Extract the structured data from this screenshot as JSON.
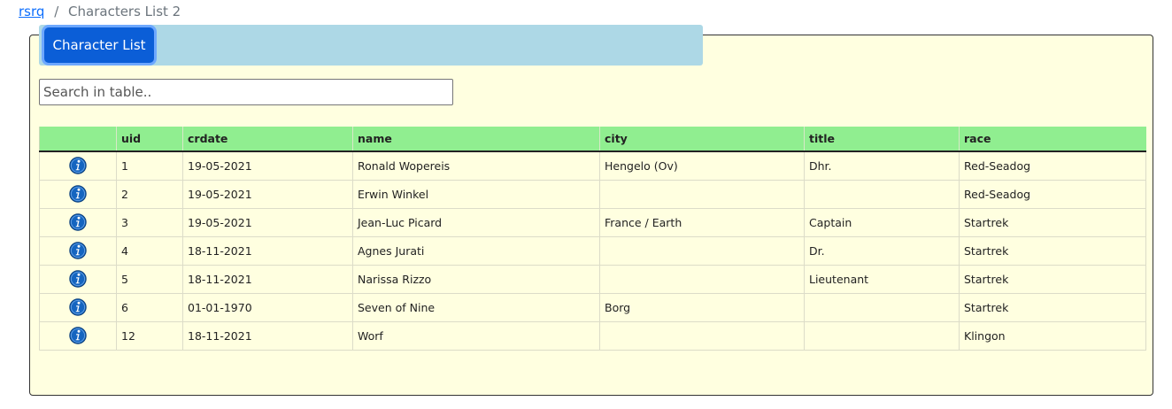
{
  "breadcrumb": {
    "home_label": "rsrq",
    "separator": "/",
    "current": "Characters List 2"
  },
  "tabs": {
    "active_label": "Character List"
  },
  "search": {
    "placeholder": "Search in table..",
    "value": ""
  },
  "table": {
    "columns": [
      "",
      "uid",
      "crdate",
      "name",
      "city",
      "title",
      "race"
    ],
    "row_icon": "info-icon",
    "rows": [
      {
        "uid": "1",
        "crdate": "19-05-2021",
        "name": "Ronald Wopereis",
        "city": "Hengelo (Ov)",
        "title": "Dhr.",
        "race": "Red-Seadog"
      },
      {
        "uid": "2",
        "crdate": "19-05-2021",
        "name": "Erwin Winkel",
        "city": "",
        "title": "",
        "race": "Red-Seadog"
      },
      {
        "uid": "3",
        "crdate": "19-05-2021",
        "name": "Jean-Luc Picard",
        "city": "France / Earth",
        "title": "Captain",
        "race": "Startrek"
      },
      {
        "uid": "4",
        "crdate": "18-11-2021",
        "name": "Agnes Jurati",
        "city": "",
        "title": "Dr.",
        "race": "Startrek"
      },
      {
        "uid": "5",
        "crdate": "18-11-2021",
        "name": "Narissa Rizzo",
        "city": "",
        "title": "Lieutenant",
        "race": "Startrek"
      },
      {
        "uid": "6",
        "crdate": "01-01-1970",
        "name": "Seven of Nine",
        "city": "Borg",
        "title": "",
        "race": "Startrek"
      },
      {
        "uid": "12",
        "crdate": "18-11-2021",
        "name": "Worf",
        "city": "",
        "title": "",
        "race": "Klingon"
      }
    ]
  },
  "colors": {
    "panel_bg": "#ffffe0",
    "tabbar_bg": "#add8e6",
    "button_bg": "#0b5ed7",
    "header_bg": "#90ee90",
    "icon_blue": "#1565c0"
  }
}
